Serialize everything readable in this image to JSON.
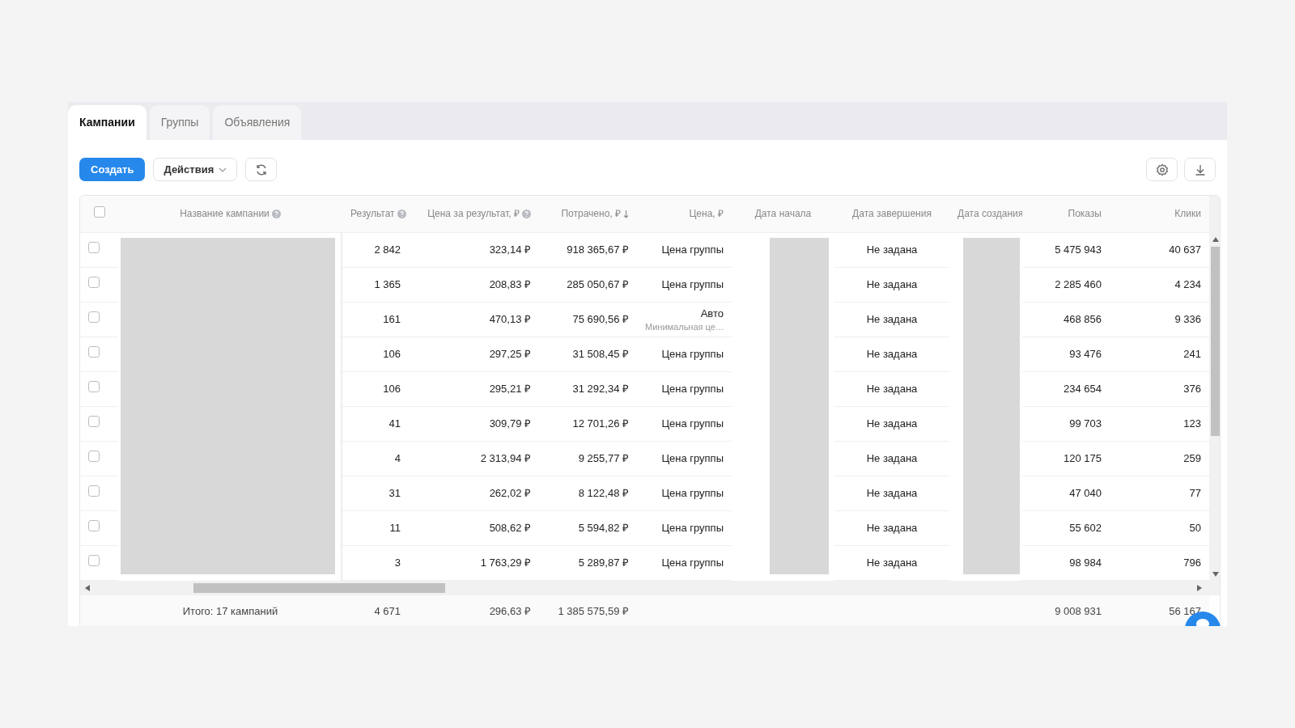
{
  "tabs": [
    {
      "label": "Кампании",
      "selected": true
    },
    {
      "label": "Группы",
      "selected": false
    },
    {
      "label": "Объявления",
      "selected": false
    }
  ],
  "toolbar": {
    "create": "Создать",
    "actions": "Действия"
  },
  "columns": [
    {
      "kind": "check",
      "selected": false
    },
    {
      "kind": "redacted",
      "label": "Название кампании",
      "help": true,
      "sorted": false,
      "total": "Итого: 17 кампаний"
    },
    {
      "kind": "number",
      "label": "Результат",
      "help": true,
      "sorted": false,
      "total": "4 671"
    },
    {
      "kind": "number",
      "label": "Цена за результат, ₽",
      "help": true,
      "sorted": false,
      "total": "296,63 ₽"
    },
    {
      "kind": "number",
      "label": "Потрачено, ₽",
      "help": false,
      "sorted": true,
      "total": "1 385 575,59 ₽"
    },
    {
      "kind": "price",
      "label": "Цена, ₽",
      "help": false,
      "sorted": false
    },
    {
      "kind": "redacted",
      "label": "Дата начала",
      "help": false,
      "sorted": false
    },
    {
      "kind": "text",
      "label": "Дата завершения",
      "help": false,
      "sorted": false
    },
    {
      "kind": "redacted",
      "label": "Дата создания",
      "help": false,
      "sorted": false
    },
    {
      "kind": "number",
      "label": "Показы",
      "help": false,
      "sorted": false,
      "total": "9 008 931"
    },
    {
      "kind": "number",
      "label": "Клики",
      "help": false,
      "sorted": false,
      "total": "56 167"
    }
  ],
  "rows": [
    {
      "selected": false,
      "cells": [
        "2 842",
        "323,14 ₽",
        "918 365,67 ₽",
        "Цена группы",
        "Не задана",
        "5 475 943",
        "40 637"
      ]
    },
    {
      "selected": false,
      "cells": [
        "1 365",
        "208,83 ₽",
        "285 050,67 ₽",
        "Цена группы",
        "Не задана",
        "2 285 460",
        "4 234"
      ]
    },
    {
      "selected": false,
      "cells": [
        "161",
        "470,13 ₽",
        "75 690,56 ₽",
        {
          "main": "Авто",
          "sub": "Минимальная це…"
        },
        "Не задана",
        "468 856",
        "9 336"
      ]
    },
    {
      "selected": false,
      "cells": [
        "106",
        "297,25 ₽",
        "31 508,45 ₽",
        "Цена группы",
        "Не задана",
        "93 476",
        "241"
      ]
    },
    {
      "selected": false,
      "cells": [
        "106",
        "295,21 ₽",
        "31 292,34 ₽",
        "Цена группы",
        "Не задана",
        "234 654",
        "376"
      ]
    },
    {
      "selected": false,
      "cells": [
        "41",
        "309,79 ₽",
        "12 701,26 ₽",
        "Цена группы",
        "Не задана",
        "99 703",
        "123"
      ]
    },
    {
      "selected": false,
      "cells": [
        "4",
        "2 313,94 ₽",
        "9 255,77 ₽",
        "Цена группы",
        "Не задана",
        "120 175",
        "259"
      ]
    },
    {
      "selected": false,
      "cells": [
        "31",
        "262,02 ₽",
        "8 122,48 ₽",
        "Цена группы",
        "Не задана",
        "47 040",
        "77"
      ]
    },
    {
      "selected": false,
      "cells": [
        "11",
        "508,62 ₽",
        "5 594,82 ₽",
        "Цена группы",
        "Не задана",
        "55 602",
        "50"
      ]
    },
    {
      "selected": false,
      "cells": [
        "3",
        "1 763,29 ₽",
        "5 289,87 ₽",
        "Цена группы",
        "Не задана",
        "98 984",
        "796"
      ]
    }
  ]
}
